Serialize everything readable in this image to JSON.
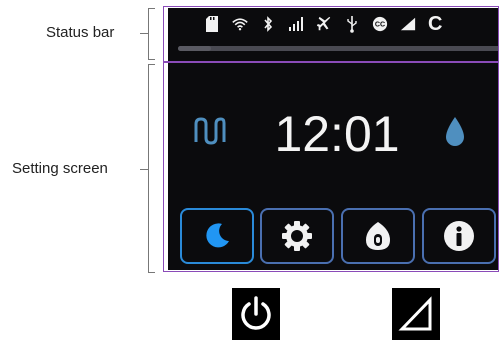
{
  "callouts": {
    "status_bar": "Status bar",
    "setting_screen": "Setting screen"
  },
  "status_bar": {
    "icons": [
      "sd-card-icon",
      "wifi-icon",
      "bluetooth-icon",
      "signal-bars-icon",
      "airplane-icon",
      "usb-icon",
      "cc-icon",
      "signal-triangle-icon"
    ],
    "trailing_text": "C",
    "progress": 0.1
  },
  "setting_screen": {
    "time": "12:01",
    "left_icon": "wave-pipe-icon",
    "right_icon": "water-drop-icon",
    "buttons": [
      "moon-button",
      "settings-button",
      "mask-button",
      "info-button"
    ]
  },
  "hardware_buttons": [
    "power-button",
    "ramp-button"
  ],
  "colors": {
    "screen_background": "#0b0b0d",
    "accent_blue": "#2196f3",
    "drop_blue": "#4f8fbf",
    "button_border": "#4a6fb0",
    "frame": "#8a4bb8"
  }
}
